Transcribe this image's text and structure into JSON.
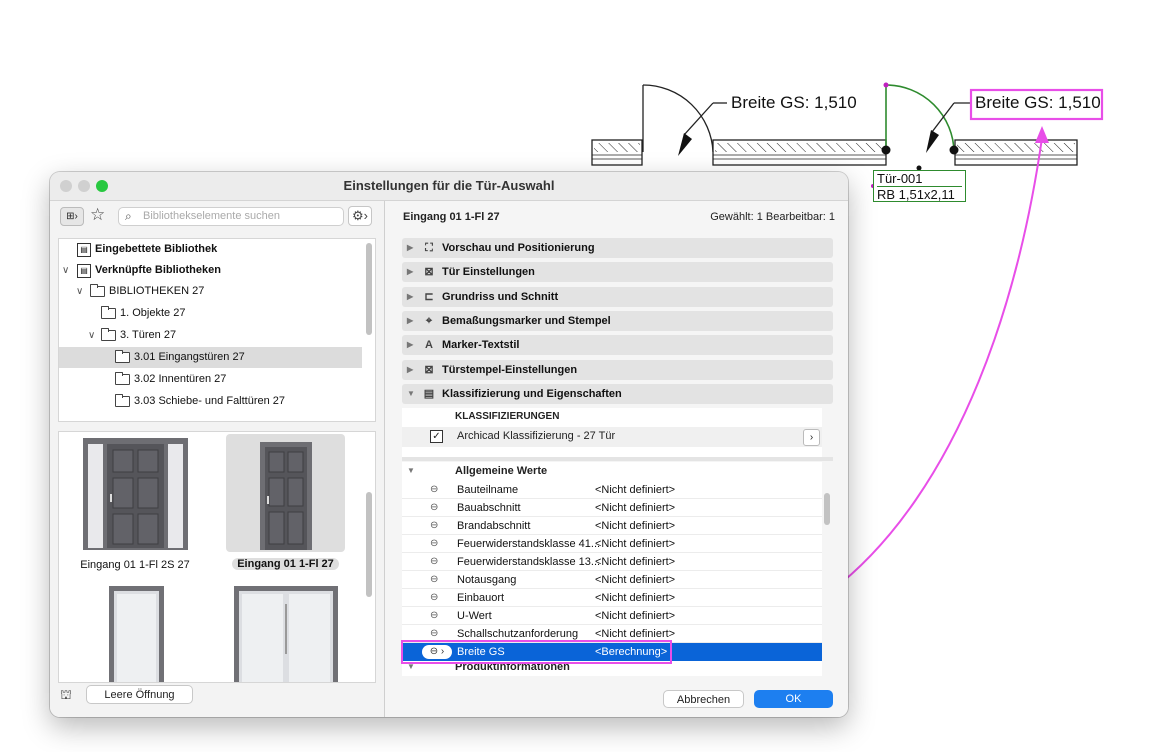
{
  "drawing": {
    "callout_left": "Breite GS: 1,510",
    "callout_right": "Breite GS: 1,510",
    "door_tag_line1": "Tür-001",
    "door_tag_line2": "RB  1,51x2,11",
    "highlight_color": "#e84ee8",
    "tag_color": "#2e8b2e"
  },
  "window": {
    "title": "Einstellungen für die Tür-Auswahl"
  },
  "left_panel": {
    "search_placeholder": "Bibliothekselemente suchen",
    "tree": [
      {
        "label": "Eingebettete Bibliothek",
        "bold": true
      },
      {
        "label": "Verknüpfte Bibliotheken",
        "bold": true
      },
      {
        "label": "BIBLIOTHEKEN 27"
      },
      {
        "label": "1. Objekte 27"
      },
      {
        "label": "3. Türen 27"
      },
      {
        "label": "3.01 Eingangstüren 27",
        "selected": true
      },
      {
        "label": "3.02 Innentüren 27"
      },
      {
        "label": "3.03 Schiebe- und Falttüren 27"
      }
    ],
    "gallery": [
      {
        "label": "Eingang 01 1-Fl 2S 27"
      },
      {
        "label": "Eingang 01 1-Fl 27",
        "selected": true
      }
    ],
    "empty_opening_button": "Leere Öffnung"
  },
  "right_panel": {
    "object_name": "Eingang 01 1-Fl 27",
    "selection_info": "Gewählt: 1 Bearbeitbar: 1",
    "sections": [
      {
        "label": "Vorschau und Positionierung",
        "icon": "preview-icon"
      },
      {
        "label": "Tür Einstellungen",
        "icon": "door-settings-icon"
      },
      {
        "label": "Grundriss und Schnitt",
        "icon": "floorplan-icon"
      },
      {
        "label": "Bemaßungsmarker und Stempel",
        "icon": "dimension-marker-icon"
      },
      {
        "label": "Marker-Textstil",
        "icon": "text-style-icon"
      },
      {
        "label": "Türstempel-Einstellungen",
        "icon": "door-stamp-icon"
      },
      {
        "label": "Klassifizierung und Eigenschaften",
        "icon": "classification-icon",
        "expanded": true
      }
    ],
    "classifications_header": "KLASSIFIZIERUNGEN",
    "classification_item": "Archicad Klassifizierung - 27 Tür",
    "general_values_header": "Allgemeine Werte",
    "properties": [
      {
        "name": "Bauteilname",
        "value": "<Nicht definiert>"
      },
      {
        "name": "Bauabschnitt",
        "value": "<Nicht definiert>"
      },
      {
        "name": "Brandabschnitt",
        "value": "<Nicht definiert>"
      },
      {
        "name": "Feuerwiderstandsklasse 41...",
        "value": "<Nicht definiert>"
      },
      {
        "name": "Feuerwiderstandsklasse 13...",
        "value": "<Nicht definiert>"
      },
      {
        "name": "Notausgang",
        "value": "<Nicht definiert>"
      },
      {
        "name": "Einbauort",
        "value": "<Nicht definiert>"
      },
      {
        "name": "U-Wert",
        "value": "<Nicht definiert>"
      },
      {
        "name": "Schallschutzanforderung",
        "value": "<Nicht definiert>"
      },
      {
        "name": "Breite GS",
        "value": "<Berechnung>",
        "selected": true
      }
    ],
    "product_info_header": "Produktinformationen",
    "cancel_button": "Abbrechen",
    "ok_button": "OK"
  }
}
